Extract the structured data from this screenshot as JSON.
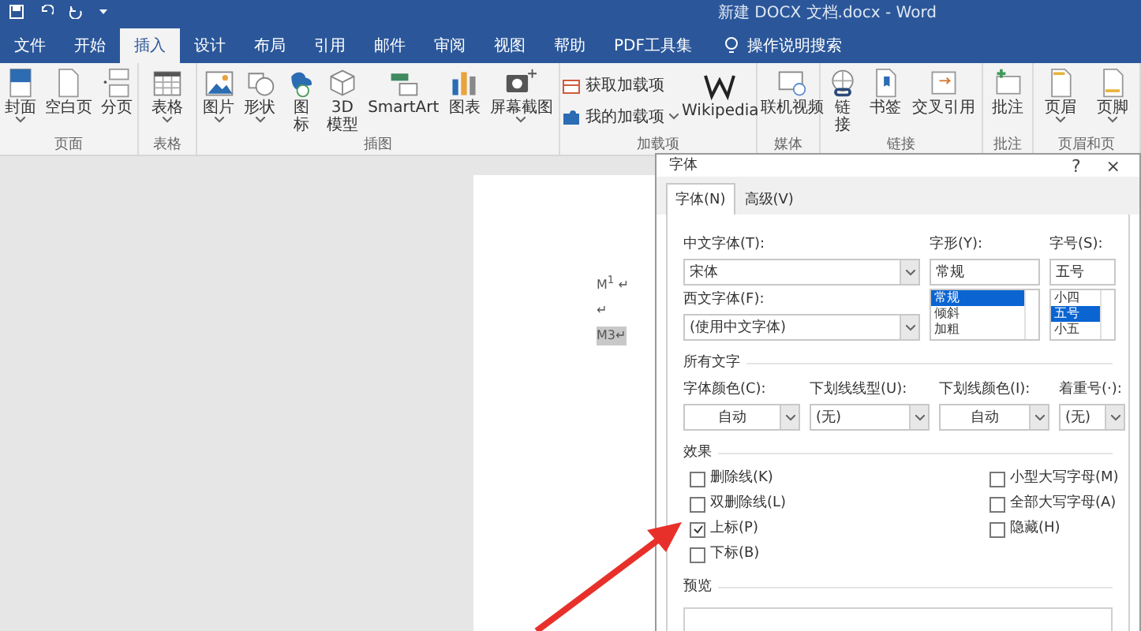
{
  "window": {
    "title": "新建 DOCX 文档.docx  -  Word"
  },
  "ribbon_tabs": [
    {
      "label": "文件",
      "selected": false
    },
    {
      "label": "开始",
      "selected": false
    },
    {
      "label": "插入",
      "selected": true
    },
    {
      "label": "设计",
      "selected": false
    },
    {
      "label": "布局",
      "selected": false
    },
    {
      "label": "引用",
      "selected": false
    },
    {
      "label": "邮件",
      "selected": false
    },
    {
      "label": "审阅",
      "selected": false
    },
    {
      "label": "视图",
      "selected": false
    },
    {
      "label": "帮助",
      "selected": false
    },
    {
      "label": "PDF工具集",
      "selected": false
    }
  ],
  "search_hint": "操作说明搜索",
  "ribbon_groups": [
    {
      "label": "页面",
      "items": [
        {
          "kind": "large",
          "label": "封面",
          "dropdown": true
        },
        {
          "kind": "large",
          "label": "空白页",
          "dropdown": false
        },
        {
          "kind": "large",
          "label": "分页",
          "dropdown": false
        }
      ]
    },
    {
      "label": "表格",
      "items": [
        {
          "kind": "large",
          "label": "表格",
          "dropdown": true
        }
      ]
    },
    {
      "label": "插图",
      "items": [
        {
          "kind": "large",
          "label": "图片",
          "dropdown": true
        },
        {
          "kind": "large",
          "label": "形状",
          "dropdown": true
        },
        {
          "kind": "stacked",
          "label": "图标",
          "dropdown": false
        },
        {
          "kind": "large",
          "label": "3D\n模型",
          "dropdown": false
        },
        {
          "kind": "large",
          "label": "SmartArt",
          "dropdown": false
        },
        {
          "kind": "large",
          "label": "图表",
          "dropdown": false
        },
        {
          "kind": "large",
          "label": "屏幕截图",
          "dropdown": true
        }
      ]
    },
    {
      "label": "加载项",
      "items": [
        {
          "kind": "small",
          "label": "获取加载项",
          "dropdown": false
        },
        {
          "kind": "small",
          "label": "我的加载项",
          "dropdown": true
        },
        {
          "kind": "large",
          "label": "Wikipedia",
          "dropdown": false
        }
      ]
    },
    {
      "label": "媒体",
      "items": [
        {
          "kind": "large",
          "label": "联机视频",
          "dropdown": false
        }
      ]
    },
    {
      "label": "链接",
      "items": [
        {
          "kind": "stacked",
          "label": "链接",
          "dropdown": false
        },
        {
          "kind": "large",
          "label": "书签",
          "dropdown": false
        },
        {
          "kind": "large",
          "label": "交叉引用",
          "dropdown": false
        }
      ]
    },
    {
      "label": "批注",
      "items": [
        {
          "kind": "large",
          "label": "批注",
          "dropdown": false
        }
      ]
    },
    {
      "label": "页眉和页",
      "items": [
        {
          "kind": "large",
          "label": "页眉",
          "dropdown": true
        },
        {
          "kind": "large",
          "label": "页脚",
          "dropdown": true
        }
      ]
    }
  ],
  "document": {
    "lines": [
      {
        "text": "M$^{1}$ ↵",
        "selected": false
      },
      {
        "text": "↵",
        "selected": false
      },
      {
        "text": "M3↵",
        "selected": true
      }
    ]
  },
  "dialog": {
    "title": "字体",
    "help": "?",
    "close": "×",
    "tabs": [
      {
        "label": "字体(N)",
        "selected": true
      },
      {
        "label": "高级(V)",
        "selected": false
      }
    ],
    "chinese_font": {
      "label": "中文字体(T):",
      "value": "宋体"
    },
    "western_font": {
      "label": "西文字体(F):",
      "value": "(使用中文字体)"
    },
    "style": {
      "label": "字形(Y):",
      "value": "常规",
      "options": [
        {
          "label": "常规",
          "selected": true
        },
        {
          "label": "倾斜",
          "selected": false
        },
        {
          "label": "加粗",
          "selected": false
        }
      ]
    },
    "size": {
      "label": "字号(S):",
      "value": "五号",
      "options": [
        {
          "label": "小四",
          "selected": false
        },
        {
          "label": "五号",
          "selected": true
        },
        {
          "label": "小五",
          "selected": false
        }
      ]
    },
    "all_text_heading": "所有文字",
    "all_text_fields": [
      {
        "label": "字体颜色(C):",
        "value": "自动",
        "centered": true
      },
      {
        "label": "下划线线型(U):",
        "value": "(无)",
        "centered": false
      },
      {
        "label": "下划线颜色(I):",
        "value": "自动",
        "centered": true
      },
      {
        "label": "着重号(·):",
        "value": "(无)",
        "centered": false
      }
    ],
    "effects_heading": "效果",
    "effects_left": [
      {
        "label": "删除线(K)",
        "checked": false
      },
      {
        "label": "双删除线(L)",
        "checked": false
      },
      {
        "label": "上标(P)",
        "checked": true
      },
      {
        "label": "下标(B)",
        "checked": false
      }
    ],
    "effects_right": [
      {
        "label": "小型大写字母(M)",
        "checked": false
      },
      {
        "label": "全部大写字母(A)",
        "checked": false
      },
      {
        "label": "隐藏(H)",
        "checked": false
      }
    ],
    "preview_heading": "预览"
  }
}
